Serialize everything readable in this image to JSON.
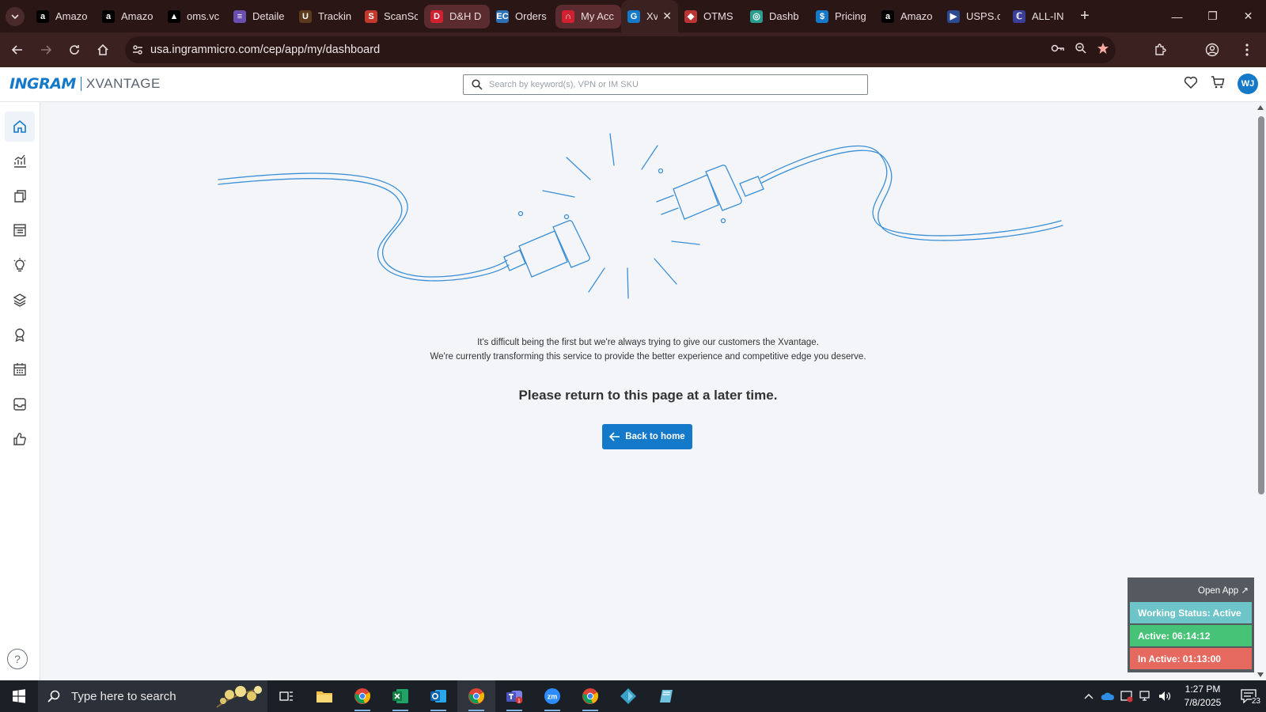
{
  "browser": {
    "tabs": [
      {
        "label": "Amazo",
        "fav": "a",
        "fav_color": "#000000"
      },
      {
        "label": "Amazo",
        "fav": "a",
        "fav_color": "#000000"
      },
      {
        "label": "oms.vc",
        "fav": "▲",
        "fav_color": "#000000"
      },
      {
        "label": "Detaile",
        "fav": "≡",
        "fav_color": "#6a4fb0"
      },
      {
        "label": "Trackin",
        "fav": "U",
        "fav_color": "#5b3a1d"
      },
      {
        "label": "ScanSc",
        "fav": "S",
        "fav_color": "#c0392b"
      },
      {
        "label": "D&H D",
        "fav": "D",
        "fav_color": "#d1202f"
      },
      {
        "label": "Orders",
        "fav": "EC",
        "fav_color": "#2b6fb4"
      },
      {
        "label": "My Acc",
        "fav": "∩",
        "fav_color": "#d1202f"
      },
      {
        "label": "Xv",
        "fav": "G",
        "fav_color": "#1479c9"
      },
      {
        "label": "OTMS",
        "fav": "◆",
        "fav_color": "#b33"
      },
      {
        "label": "Dashb",
        "fav": "◎",
        "fav_color": "#2a9d8f"
      },
      {
        "label": "Pricing",
        "fav": "$",
        "fav_color": "#1479c9"
      },
      {
        "label": "Amazo",
        "fav": "a",
        "fav_color": "#000000"
      },
      {
        "label": "USPS.c",
        "fav": "▶",
        "fav_color": "#2b4a8f"
      },
      {
        "label": "ALL-IN",
        "fav": "ℂ",
        "fav_color": "#3a3f9a"
      }
    ],
    "url": "usa.ingrammicro.com/cep/app/my/dashboard"
  },
  "app": {
    "logo_brand": "INGRAM",
    "logo_product": "XVANTAGE",
    "search_placeholder": "Search by keyword(s), VPN or IM SKU",
    "avatar_initials": "WJ",
    "accent": "#1479c9"
  },
  "sidebar": {
    "items": [
      "home-icon",
      "analytics-icon",
      "catalog-icon",
      "orders-icon",
      "insights-icon",
      "services-icon",
      "rewards-icon",
      "calendar-icon",
      "inbox-icon",
      "feedback-icon"
    ]
  },
  "main": {
    "message_line1": "It's difficult being the first but we're always trying to give our customers the Xvantage.",
    "message_line2": "We're currently transforming this service to provide the better experience and competitive edge you deserve.",
    "headline": "Please return to this page at a later time.",
    "back_button": "Back to home"
  },
  "tracker": {
    "open_app": "Open App ↗",
    "working_status": "Working Status: Active",
    "active": "Active: 06:14:12",
    "inactive": "In Active: 01:13:00"
  },
  "taskbar": {
    "search_text": "Type here to search",
    "time": "1:27 PM",
    "date": "7/8/2025",
    "notifications": "23"
  }
}
